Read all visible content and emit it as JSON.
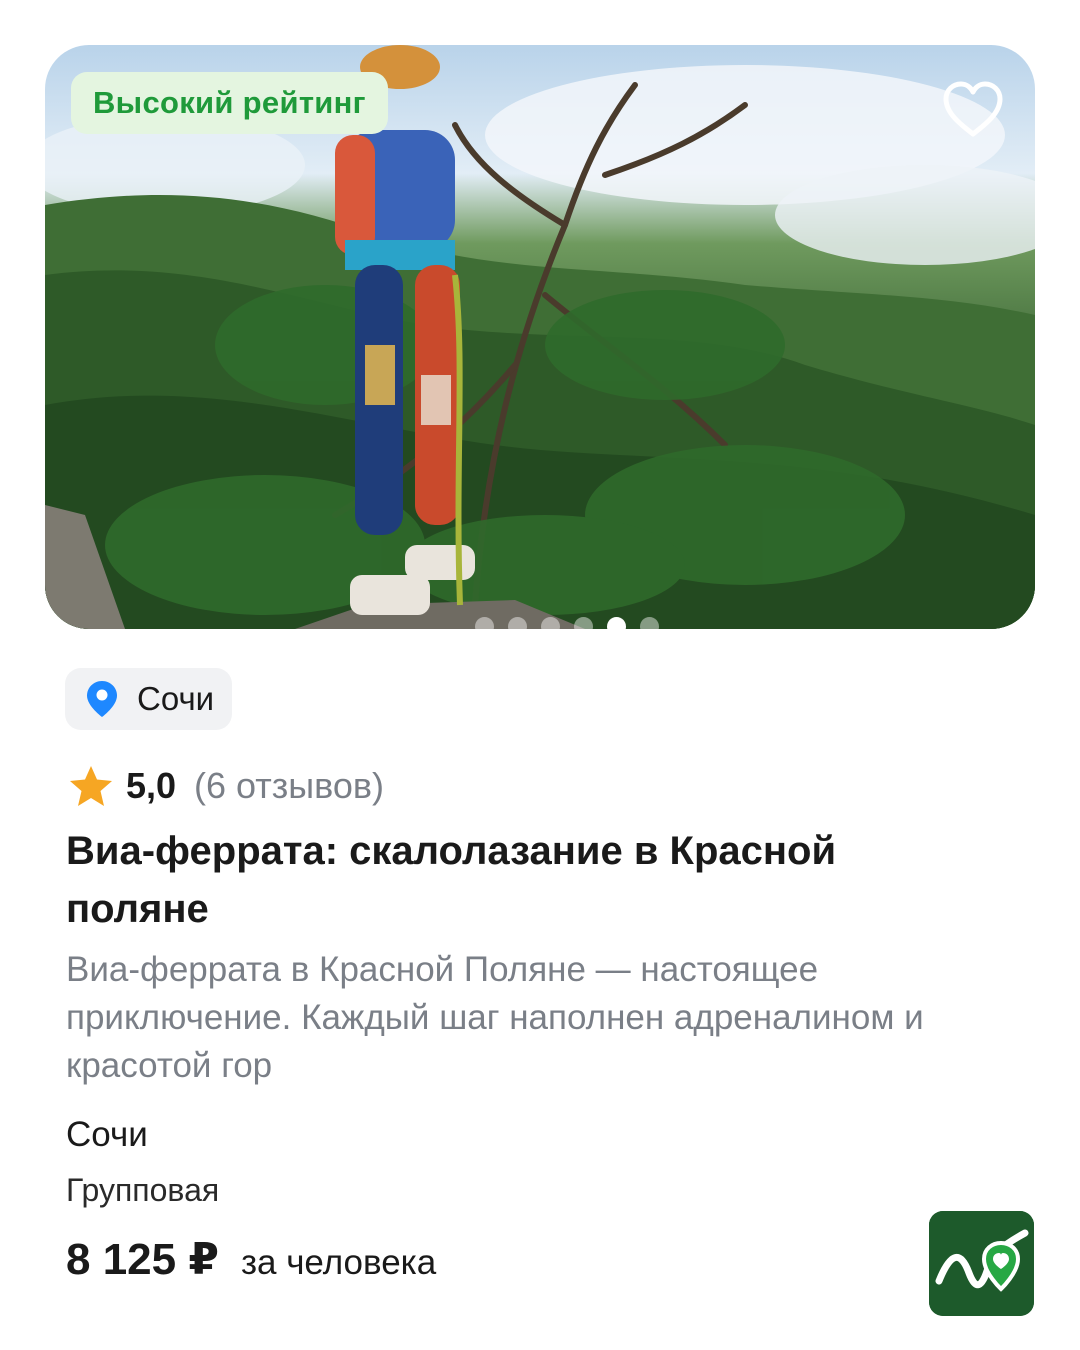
{
  "card": {
    "badge": "Высокий рейтинг",
    "carousel": {
      "total": 6,
      "active_index": 4
    },
    "location_chip": "Сочи",
    "rating": {
      "value": "5,0",
      "reviews": "(6 отзывов)"
    },
    "title": "Виа-феррата: скалолазание в Красной поляне",
    "description": "Виа-феррата в Красной Поляне — настоящее приключение. Каждый шаг наполнен адреналином и красотой гор",
    "city": "Сочи",
    "tour_type": "Групповая",
    "price": "8 125 ₽",
    "price_unit": "за человека"
  },
  "colors": {
    "badge_text": "#1f9a3a",
    "badge_bg": "#e4f5e0",
    "pin": "#1e88ff",
    "star": "#f6a623",
    "logo_bg": "#1d5a2b"
  },
  "icons": {
    "favorite": "heart-outline-icon",
    "location": "map-pin-icon",
    "rating": "star-icon",
    "brand": "brand-logo-icon"
  }
}
